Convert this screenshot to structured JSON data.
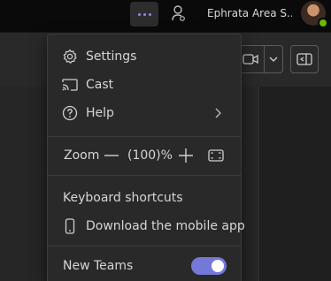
{
  "titlebar": {
    "tenant_name": "Ephrata Area S...",
    "more_icon": "more-horizontal-icon",
    "accent": "#8b8cf2"
  },
  "background": {
    "partial_text": "........"
  },
  "menu": {
    "items": [
      {
        "label": "Settings",
        "icon": "gear-icon"
      },
      {
        "label": "Cast",
        "icon": "cast-icon"
      },
      {
        "label": "Help",
        "icon": "help-icon"
      }
    ],
    "zoom": {
      "label": "Zoom",
      "value": "(100)%"
    },
    "keyboard_shortcuts": "Keyboard shortcuts",
    "download_mobile": "Download the mobile app",
    "new_teams": {
      "label": "New Teams",
      "enabled": true,
      "toggle_color": "#7478d6"
    }
  }
}
